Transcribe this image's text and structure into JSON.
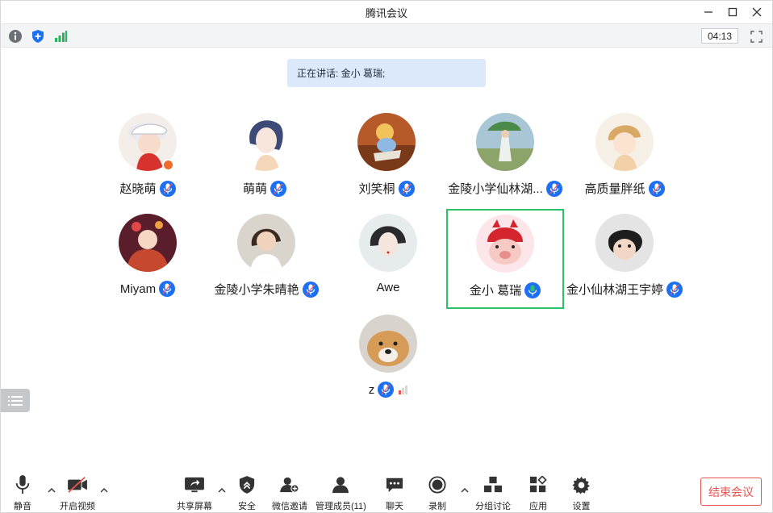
{
  "window": {
    "title": "腾讯会议"
  },
  "status": {
    "timer": "04:13"
  },
  "banner": {
    "speaking": "正在讲话: 金小 葛瑞;"
  },
  "participants": [
    {
      "name": "赵晓萌",
      "mic": "muted"
    },
    {
      "name": "萌萌",
      "mic": "muted"
    },
    {
      "name": "刘笑桐",
      "mic": "muted"
    },
    {
      "name": "金陵小学仙林湖...",
      "mic": "muted"
    },
    {
      "name": "高质量胖纸",
      "mic": "muted"
    },
    {
      "name": "Miyam",
      "mic": "muted"
    },
    {
      "name": "金陵小学朱晴艳",
      "mic": "muted"
    },
    {
      "name": "Awe",
      "mic": "none"
    },
    {
      "name": "金小 葛瑞",
      "mic": "speaking"
    },
    {
      "name": "金小仙林湖王宇婷",
      "mic": "muted"
    },
    {
      "name": "z",
      "mic": "muted"
    }
  ],
  "toolbar": {
    "mute": "静音",
    "video": "开启视频",
    "share": "共享屏幕",
    "security": "安全",
    "invite": "微信邀请",
    "members": "管理成员(11)",
    "chat": "聊天",
    "record": "录制",
    "breakout": "分组讨论",
    "apps": "应用",
    "settings": "设置",
    "end": "结束会议"
  },
  "colors": {
    "accent": "#1d6ff3",
    "speaking": "#2cc069",
    "end": "#e5544f",
    "banner": "#dbe9fb"
  },
  "icons": [
    "info-icon",
    "shield-icon",
    "signal-icon",
    "fullscreen-icon",
    "minimize-icon",
    "maximize-icon",
    "close-icon"
  ]
}
